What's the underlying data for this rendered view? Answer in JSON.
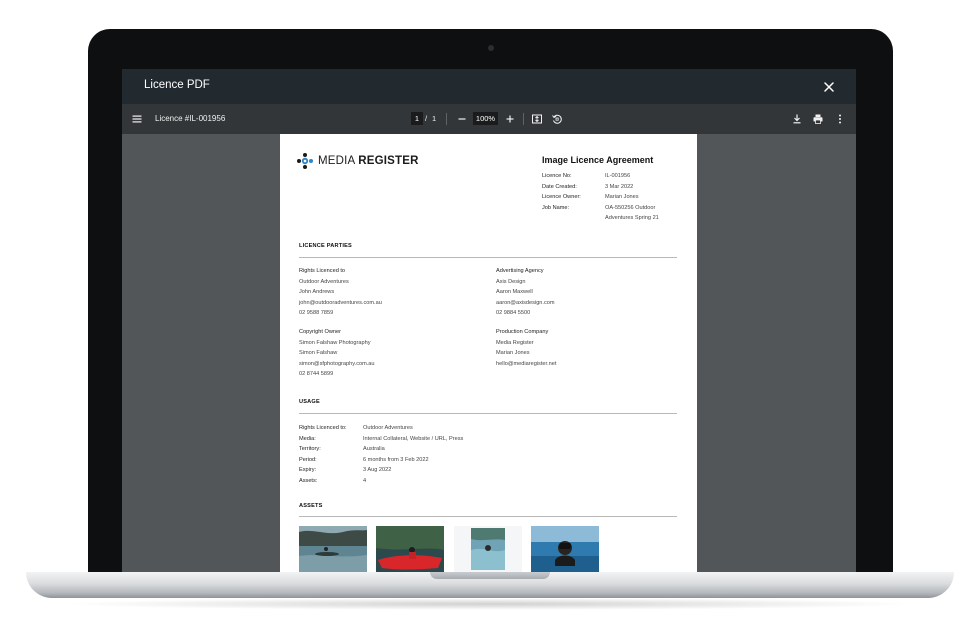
{
  "modal": {
    "title": "Licence PDF"
  },
  "toolbar": {
    "doc_name": "Licence #IL-001956",
    "page_current": "1",
    "page_sep": "/",
    "page_total": "1",
    "zoom": "100%"
  },
  "document": {
    "logo": {
      "text_light": "MEDIA",
      "text_bold": "REGISTER"
    },
    "title": "Image Licence Agreement",
    "meta": [
      {
        "key": "Licence No:",
        "value": "IL-001956"
      },
      {
        "key": "Date Created:",
        "value": "3 Mar 2022"
      },
      {
        "key": "Licence Owner:",
        "value": "Marian Jones"
      },
      {
        "key": "Job Name:",
        "value": "OA-550256 Outdoor"
      },
      {
        "key": "",
        "value": "Adventures Spring 21"
      }
    ],
    "parties_title": "LICENCE PARTIES",
    "parties": [
      {
        "heading": "Rights Licenced to",
        "lines": [
          "Outdoor Adventures",
          "John Andrews",
          "john@outdooradventures.com.au",
          "02 9588 7859"
        ]
      },
      {
        "heading": "Advertising Agency",
        "lines": [
          "Axis Design",
          "Aaron Maxwell",
          "aaron@axisdesign.com",
          "02 9884 5500"
        ]
      },
      {
        "heading": "Copyright Owner",
        "lines": [
          "Simon Falshaw Photography",
          "Simon Falshaw",
          "simon@sfphotography.com.au",
          "02 8744 5899"
        ]
      },
      {
        "heading": "Production Company",
        "lines": [
          "Media Register",
          "Marian Jones",
          "hello@mediaregister.net"
        ]
      }
    ],
    "usage_title": "USAGE",
    "usage": [
      {
        "key": "Rights Licenced to:",
        "value": "Outdoor Adventures"
      },
      {
        "key": "Media:",
        "value": "Internal Collateral, Website / URL, Press"
      },
      {
        "key": "Territory:",
        "value": "Australia"
      },
      {
        "key": "Period:",
        "value": "6 months from 3 Feb 2022"
      },
      {
        "key": "Expiry:",
        "value": "3 Aug 2022"
      },
      {
        "key": "Assets:",
        "value": "4"
      }
    ],
    "assets_title": "ASSETS"
  },
  "icons": {
    "close": "close-icon",
    "menu": "menu-icon",
    "zoom_out": "minus-icon",
    "zoom_in": "plus-icon",
    "fit": "fit-page-icon",
    "rotate": "rotate-icon",
    "download": "download-icon",
    "print": "print-icon",
    "more": "more-vertical-icon"
  },
  "colors": {
    "modal_header": "#222a30",
    "toolbar": "#323639",
    "viewer_bg": "#525659",
    "brand_blue": "#2f86c8"
  }
}
